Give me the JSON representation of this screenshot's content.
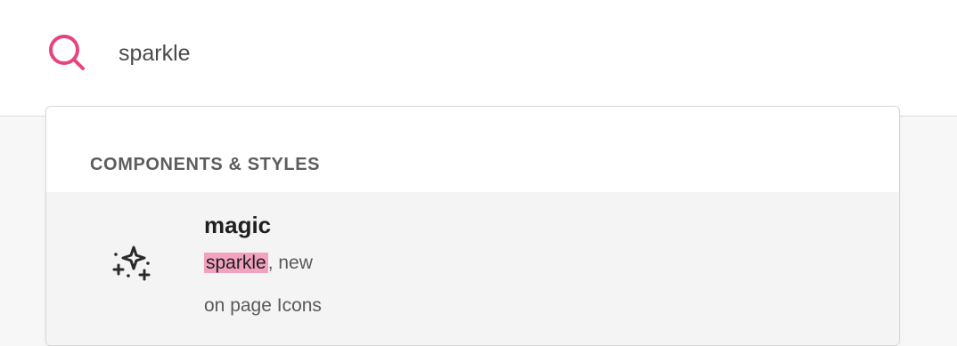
{
  "search": {
    "value": "sparkle",
    "placeholder": ""
  },
  "colors": {
    "accent": "#e8437f",
    "highlight": "#f2a1bf"
  },
  "results": {
    "section_header": "COMPONENTS & STYLES",
    "items": [
      {
        "icon": "sparkle-icon",
        "name": "magic",
        "tag_match": "sparkle",
        "tag_rest": ", new",
        "location": "on page Icons"
      }
    ]
  }
}
